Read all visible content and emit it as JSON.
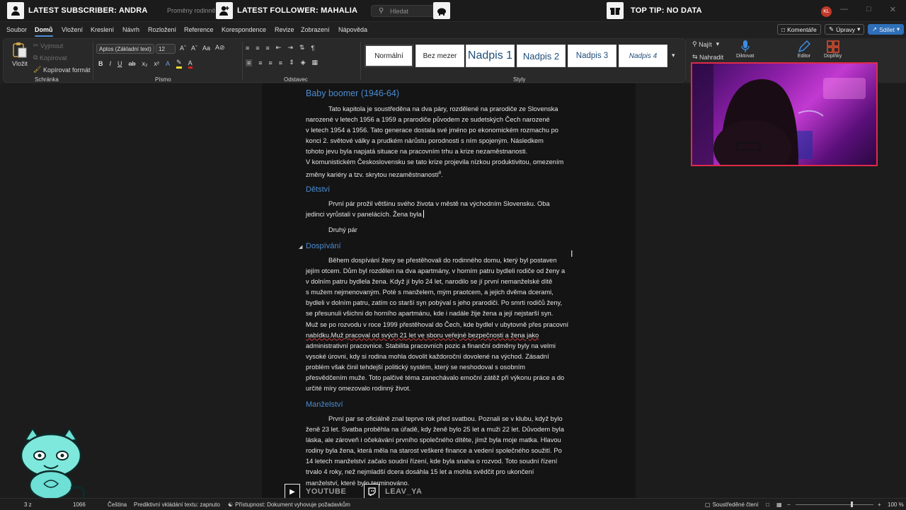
{
  "overlay": {
    "subscriber": "LATEST SUBSCRIBER: ANDRA",
    "follower": "LATEST FOLLOWER: MAHALIA",
    "top_tip": "TOP TIP: NO DATA",
    "youtube": "YOUTUBE",
    "twitch": "LEAV_YA"
  },
  "titlebar": {
    "doc_title": "Proměny rodinně",
    "search_placeholder": "Hledat",
    "user_initials": "KL"
  },
  "menu": {
    "items": [
      "Soubor",
      "Domů",
      "Vložení",
      "Kreslení",
      "Návrh",
      "Rozložení",
      "Reference",
      "Korespondence",
      "Revize",
      "Zobrazení",
      "Nápověda"
    ],
    "active": "Domů",
    "comments": "Komentáře",
    "editing": "Úpravy",
    "share": "Sdílet"
  },
  "ribbon": {
    "clipboard": {
      "paste": "Vložit",
      "cut": "Vyjmout",
      "copy": "Kopírovat",
      "format_painter": "Kopírovat formát",
      "label": "Schránka"
    },
    "font": {
      "family": "Aptos (Základní text)",
      "size": "12",
      "label": "Písmo"
    },
    "paragraph": {
      "label": "Odstavec"
    },
    "styles": {
      "items": [
        "Normální",
        "Bez mezer",
        "Nadpis 1",
        "Nadpis 2",
        "Nadpis 3",
        "Nadpis 4"
      ],
      "label": "Styly"
    },
    "editing": {
      "find": "Najít",
      "replace": "Nahradit"
    },
    "dictate": "Diktovat",
    "editor": "Editor",
    "addins": "Doplňky"
  },
  "document": {
    "h_baby": "Baby boomer (1946-64)",
    "p_baby": [
      "Tato kapitola je soustředěna na dva páry, rozdělené na prarodiče ze Slovenska",
      "narozené v letech 1956 a 1959 a prarodiče původem ze sudetských Čech narozené",
      "v letech 1954 a 1956. Tato generace dostala své jméno po ekonomickém rozmachu po",
      "konci 2. světové války a prudkém nárůstu porodnosti s ním spojeným. Následkem",
      "tohoto jevu byla napjatá situace na pracovním trhu a krize nezaměstnanosti.",
      "V komunistickém Československu se tato krize projevila nízkou produktivitou, omezením",
      "změny kariéry a tzv. skrytou nezaměstnaností"
    ],
    "fn_mark": "8",
    "p_baby_end": ".",
    "h_detstvi": "Dětství",
    "p_detstvi": [
      "První pár prožil většinu svého života v městě na východním Slovensku. Oba",
      "jedinci vyrůstali v panelácích. Žena byla"
    ],
    "p_druhy": "Druhý pár",
    "h_dospivani": "Dospívání",
    "p_dospivani": [
      "Během dospívání ženy se přestěhovali do rodinného domu, který byl postaven",
      "jejím otcem. Dům byl rozdělen na dva apartmány, v horním patru bydleli rodiče od ženy a",
      "v dolním patru bydlela žena. Když jí bylo 24 let, narodilo se jí první nemanželské dítě",
      "s mužem nejmenovaným. Poté s manželem, mým praotcem, a jejich dvěma dcerami,",
      "bydleli v dolním patru, zatím co starší syn pobýval s jeho prarodiči. Po smrti rodičů ženy,",
      "se přesunuli všichni do horního apartmánu, kde i nadále žije žena a její nejstarší syn.",
      "Muž se po rozvodu v roce 1999 přestěhoval do Čech, kde bydlel v ubytovně přes pracovní",
      "nabídku.Muž pracoval od svých 21 let ve sboru veřejné bezpečnosti a žena jako",
      "administrativní pracovnice. Stabilita pracovních pozic a finanční odměny byly na velmi",
      "vysoké úrovni, kdy si rodina mohla dovolit každoroční dovolené na východ. Zásadní",
      "problém však činil tehdejší politický systém, který se neshodoval s osobním",
      "přesvědčením muže. Toto palčivé téma zanechávalo emoční zátěž při výkonu práce a do",
      "určité míry omezovalo rodinný život."
    ],
    "h_manzelstvi": "Manželství",
    "p_manzelstvi": [
      "První par se oficiálně znal teprve rok před svatbou. Poznali se v klubu, když bylo",
      "ženě 23 let. Svatba proběhla na úřadě, kdy ženě bylo 25 let a muži 22 let. Důvodem byla",
      "láska, ale zároveň i očekávání prvního společného dítěte, jímž byla moje matka. Hlavou",
      "rodiny byla žena, která měla na starost veškeré finance a vedení společného soužití. Po",
      "14 letech manželství začalo soudní řízení, kde byla snaha o rozvod. Toto soudní řízení",
      "trvalo 4 roky, než nejmladší dcera dosáhla 15 let a mohla svědčit pro ukončení",
      "manželství, které bylo terminováno."
    ]
  },
  "statusbar": {
    "page_info": "3 z",
    "words": "1066",
    "language": "Čeština",
    "predictive": "Prediktivní vkládání textu: zapnuto",
    "accessibility": "Přístupnost: Dokument vyhovuje požadavkům",
    "focus": "Soustředěné čtení",
    "zoom": "100 %"
  }
}
